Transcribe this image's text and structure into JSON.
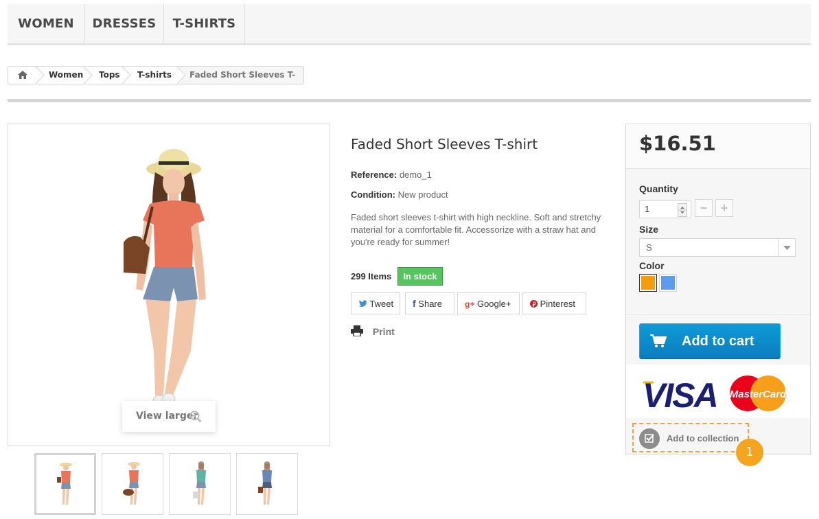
{
  "menu": {
    "items": [
      {
        "label": "WOMEN"
      },
      {
        "label": "DRESSES"
      },
      {
        "label": "T-SHIRTS"
      }
    ]
  },
  "breadcrumb": {
    "home_icon": "home-icon",
    "items": [
      "Women",
      "Tops",
      "T-shirts"
    ],
    "current": "Faded Short Sleeves T-shirt"
  },
  "product": {
    "title": "Faded Short Sleeves T-shirt",
    "reference_label": "Reference:",
    "reference_value": "demo_1",
    "condition_label": "Condition:",
    "condition_value": "New product",
    "description": "Faded short sleeves t-shirt with high neckline. Soft and stretchy material for a comfortable fit. Accessorize with a straw hat and you're ready for summer!",
    "items_count": "299 Items",
    "stock_status": "In stock",
    "view_larger": "View larger",
    "print_label": "Print"
  },
  "social": {
    "tweet": "Tweet",
    "share": "Share",
    "google": "Google+",
    "pinterest": "Pinterest"
  },
  "buy_box": {
    "price": "$16.51",
    "quantity_label": "Quantity",
    "quantity_value": "1",
    "size_label": "Size",
    "size_value": "S",
    "color_label": "Color",
    "colors": [
      "#f39c11",
      "#5d9cec"
    ],
    "add_to_cart": "Add to cart",
    "add_to_collection": "Add to collection",
    "marker_number": "1"
  },
  "colors": {
    "accent_blue": "#0e8bcf",
    "in_stock_green": "#55c65e",
    "marker_orange": "#f5a420"
  }
}
